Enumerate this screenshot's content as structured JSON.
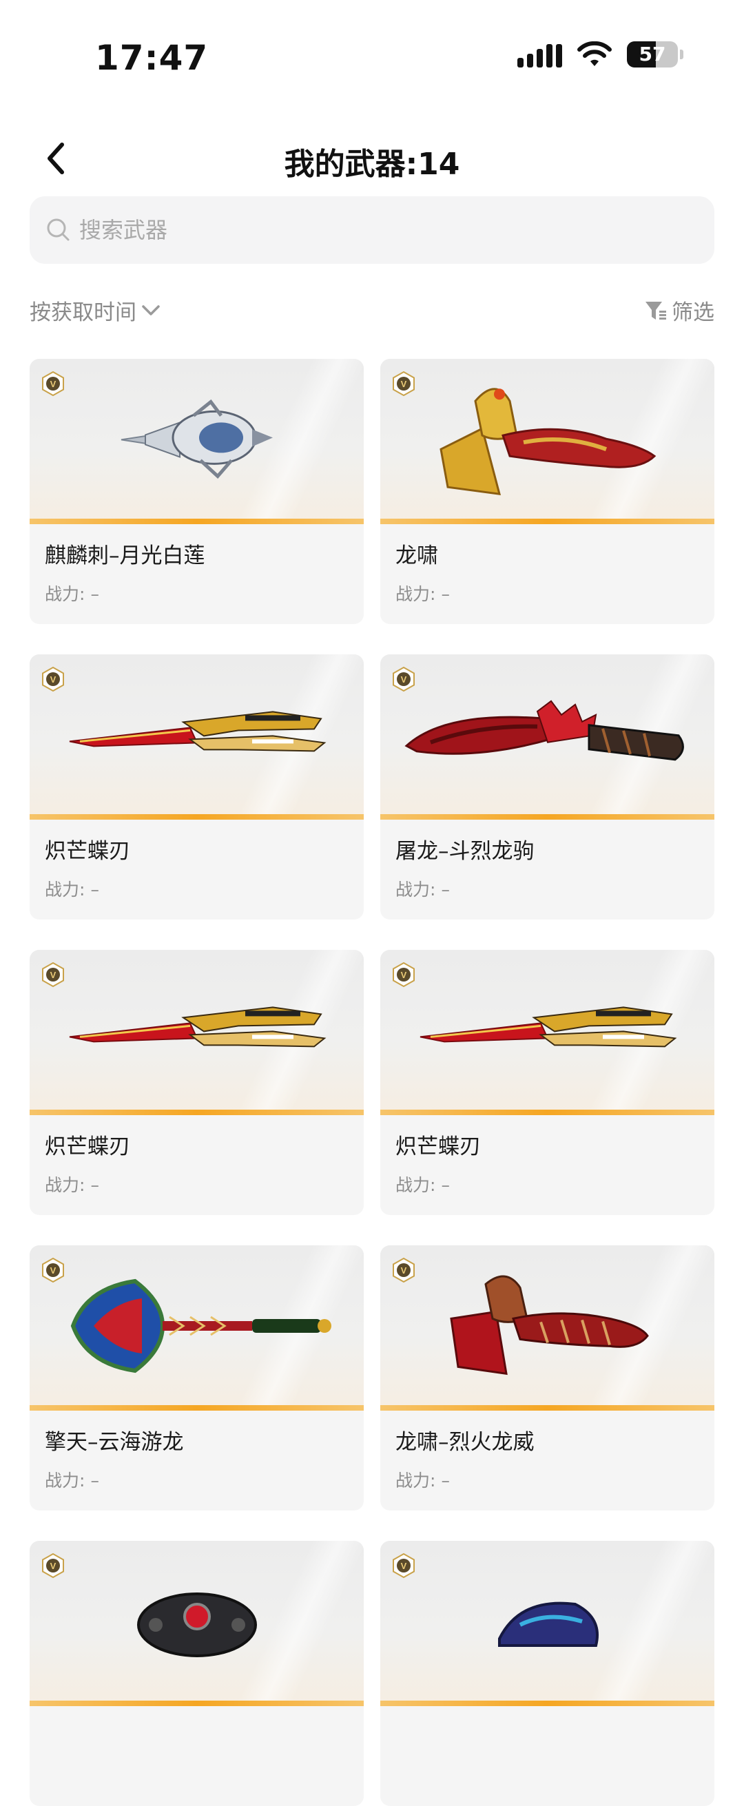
{
  "status_bar": {
    "time": "17:47",
    "battery": "57",
    "battery_level": 57
  },
  "nav": {
    "title": "我的武器:14"
  },
  "search": {
    "placeholder": "搜索武器"
  },
  "toolbar": {
    "sort_label": "按获取时间",
    "filter_label": "筛选"
  },
  "colors": {
    "accent": "#f5a623",
    "badge": "#c9a24a"
  },
  "weapons": [
    {
      "name": "麒麟刺–月光白莲",
      "power_label": "战力:",
      "power_value": "–",
      "icon": "dagger-icon"
    },
    {
      "name": "龙啸",
      "power_label": "战力:",
      "power_value": "–",
      "icon": "dragon-axe-icon"
    },
    {
      "name": "炽芒蝶刃",
      "power_label": "战力:",
      "power_value": "–",
      "icon": "butterfly-knife-icon"
    },
    {
      "name": "屠龙–斗烈龙驹",
      "power_label": "战力:",
      "power_value": "–",
      "icon": "machete-icon"
    },
    {
      "name": "炽芒蝶刃",
      "power_label": "战力:",
      "power_value": "–",
      "icon": "butterfly-knife-icon"
    },
    {
      "name": "炽芒蝶刃",
      "power_label": "战力:",
      "power_value": "–",
      "icon": "butterfly-knife-icon"
    },
    {
      "name": "擎天–云海游龙",
      "power_label": "战力:",
      "power_value": "–",
      "icon": "shovel-icon"
    },
    {
      "name": "龙啸–烈火龙威",
      "power_label": "战力:",
      "power_value": "–",
      "icon": "dragon-axe-icon"
    },
    {
      "name": "",
      "power_label": "",
      "power_value": "",
      "icon": "knuckle-icon"
    },
    {
      "name": "",
      "power_label": "",
      "power_value": "",
      "icon": "claw-icon"
    }
  ]
}
